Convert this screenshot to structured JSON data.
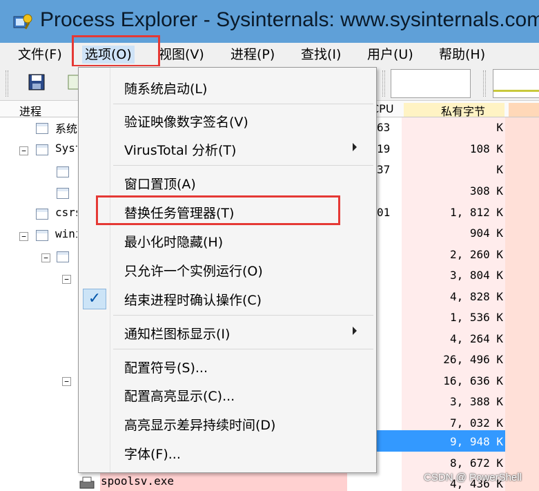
{
  "window": {
    "title": "Process Explorer - Sysinternals: www.sysinternals.com",
    "icon": "process-explorer-app-icon"
  },
  "menubar": {
    "items": [
      {
        "label": "文件(F)"
      },
      {
        "label": "选项(O)"
      },
      {
        "label": "视图(V)"
      },
      {
        "label": "进程(P)"
      },
      {
        "label": "查找(I)"
      },
      {
        "label": "用户(U)"
      },
      {
        "label": "帮助(H)"
      }
    ]
  },
  "toolbar": {
    "save_icon": "save-icon",
    "refresh_icon": "refresh-icon"
  },
  "columns": {
    "process": "进程",
    "cpu": "CPU",
    "private_bytes": "私有字节"
  },
  "processes": [
    {
      "name": "系统",
      "cpu": "63",
      "private": "K"
    },
    {
      "name": "System",
      "cpu": "19",
      "private": "108 K"
    },
    {
      "name": "",
      "cpu": "37",
      "private": "K"
    },
    {
      "name": "",
      "cpu": "",
      "private": "308 K"
    },
    {
      "name": "csrss.exe",
      "cpu": "01",
      "private": "1, 812 K"
    },
    {
      "name": "wininit.exe",
      "cpu": "",
      "private": "904 K"
    },
    {
      "name": "",
      "cpu": "",
      "private": "2, 260 K"
    },
    {
      "name": "",
      "cpu": "",
      "private": "3, 804 K"
    },
    {
      "name": "",
      "cpu": "",
      "private": "4, 828 K"
    },
    {
      "name": "",
      "cpu": "",
      "private": "1, 536 K"
    },
    {
      "name": "",
      "cpu": "",
      "private": "4, 264 K"
    },
    {
      "name": "",
      "cpu": "",
      "private": "26, 496 K"
    },
    {
      "name": "",
      "cpu": "",
      "private": "16, 636 K"
    },
    {
      "name": "",
      "cpu": "",
      "private": "3, 388 K"
    },
    {
      "name": "",
      "cpu": "",
      "private": "7, 032 K"
    },
    {
      "name": "",
      "cpu": "",
      "private": "9, 948 K"
    },
    {
      "name": "",
      "cpu": "",
      "private": "8, 672 K"
    },
    {
      "name": "spoolsv.exe",
      "cpu": "",
      "private": "4, 436 K"
    }
  ],
  "options_menu": {
    "items": [
      {
        "label": "随系统启动(L)"
      },
      {
        "label": "验证映像数字签名(V)"
      },
      {
        "label": "VirusTotal 分析(T)"
      },
      {
        "label": "窗口置顶(A)"
      },
      {
        "label": "替换任务管理器(T)"
      },
      {
        "label": "最小化时隐藏(H)"
      },
      {
        "label": "只允许一个实例运行(O)"
      },
      {
        "label": "结束进程时确认操作(C)",
        "checked": true
      },
      {
        "label": "通知栏图标显示(I)"
      },
      {
        "label": "配置符号(S)..."
      },
      {
        "label": "配置高亮显示(C)..."
      },
      {
        "label": "高亮显示差异持续时间(D)"
      },
      {
        "label": "字体(F)..."
      }
    ]
  },
  "colors": {
    "titlebar": "#5fa0d8",
    "highlight_box": "#e53935",
    "selection": "#3399ff"
  },
  "watermark": "CSDN @ PowerShell"
}
